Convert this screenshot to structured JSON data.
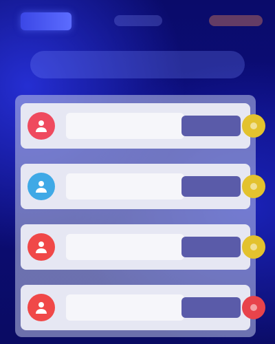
{
  "header": {
    "logo_text": "",
    "nav_link_1": "",
    "nav_link_2": ""
  },
  "hero": {
    "title": ""
  },
  "rows": [
    {
      "name": "",
      "sub": "",
      "action": "",
      "avatar_color": "#ef4a5e",
      "status_color": "#e3c22e",
      "avatar_icon": "user-icon",
      "status_icon": "badge-icon"
    },
    {
      "name": "",
      "sub": "",
      "action": "",
      "avatar_color": "#3fa9e6",
      "status_color": "#e3c22e",
      "avatar_icon": "user-icon",
      "status_icon": "badge-icon"
    },
    {
      "name": "",
      "sub": "",
      "action": "",
      "avatar_color": "#f04848",
      "status_color": "#e3c22e",
      "avatar_icon": "user-icon",
      "status_icon": "badge-icon"
    },
    {
      "name": "",
      "sub": "",
      "action": "",
      "avatar_color": "#f04848",
      "status_color": "#e8434b",
      "avatar_icon": "user-icon",
      "status_icon": "badge-icon"
    }
  ]
}
